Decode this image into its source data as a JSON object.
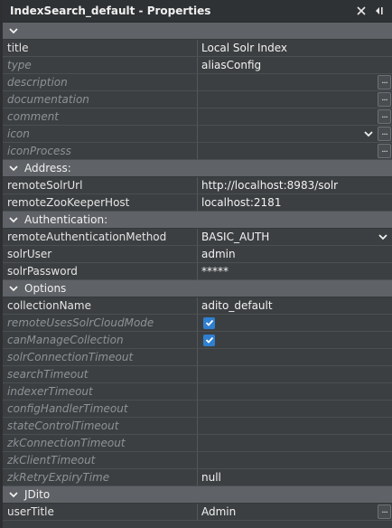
{
  "panel": {
    "title": "IndexSearch_default - Properties"
  },
  "general": [
    {
      "name": "title",
      "value": "Local Solr Index",
      "dim": false,
      "ellipsis": false,
      "dropdown": false
    },
    {
      "name": "type",
      "value": "aliasConfig",
      "dim": true,
      "ellipsis": false,
      "dropdown": false
    },
    {
      "name": "description",
      "value": "",
      "dim": true,
      "ellipsis": true,
      "dropdown": false
    },
    {
      "name": "documentation",
      "value": "",
      "dim": true,
      "ellipsis": true,
      "dropdown": false
    },
    {
      "name": "comment",
      "value": "",
      "dim": true,
      "ellipsis": true,
      "dropdown": false
    },
    {
      "name": "icon",
      "value": "",
      "dim": true,
      "ellipsis": true,
      "dropdown": true
    },
    {
      "name": "iconProcess",
      "value": "",
      "dim": true,
      "ellipsis": true,
      "dropdown": false
    }
  ],
  "sections": {
    "address": "Address:",
    "authentication": "Authentication:",
    "options": "Options",
    "jdito": "JDito"
  },
  "address": [
    {
      "name": "remoteSolrUrl",
      "value": "http://localhost:8983/solr"
    },
    {
      "name": "remoteZooKeeperHost",
      "value": "localhost:2181"
    }
  ],
  "authentication": [
    {
      "name": "remoteAuthenticationMethod",
      "value": "BASIC_AUTH"
    },
    {
      "name": "solrUser",
      "value": "admin"
    },
    {
      "name": "solrPassword",
      "value": "*****"
    }
  ],
  "options": [
    {
      "name": "collectionName",
      "value": "adito_default",
      "dim": false,
      "checkbox": false
    },
    {
      "name": "remoteUsesSolrCloudMode",
      "value": "",
      "dim": true,
      "checkbox": true
    },
    {
      "name": "canManageCollection",
      "value": "",
      "dim": true,
      "checkbox": true
    },
    {
      "name": "solrConnectionTimeout",
      "value": "",
      "dim": true,
      "checkbox": false
    },
    {
      "name": "searchTimeout",
      "value": "",
      "dim": true,
      "checkbox": false
    },
    {
      "name": "indexerTimeout",
      "value": "",
      "dim": true,
      "checkbox": false
    },
    {
      "name": "configHandlerTimeout",
      "value": "",
      "dim": true,
      "checkbox": false
    },
    {
      "name": "stateControlTimeout",
      "value": "",
      "dim": true,
      "checkbox": false
    },
    {
      "name": "zkConnectionTimeout",
      "value": "",
      "dim": true,
      "checkbox": false
    },
    {
      "name": "zkClientTimeout",
      "value": "",
      "dim": true,
      "checkbox": false
    },
    {
      "name": "zkRetryExpiryTime",
      "value": "null",
      "dim": true,
      "checkbox": false
    }
  ],
  "jdito": [
    {
      "name": "userTitle",
      "value": "Admin"
    }
  ],
  "colors": {
    "section_bg": "#5f6266",
    "row_bg": "#3c3f41",
    "checkbox": "#2f7fd0"
  }
}
